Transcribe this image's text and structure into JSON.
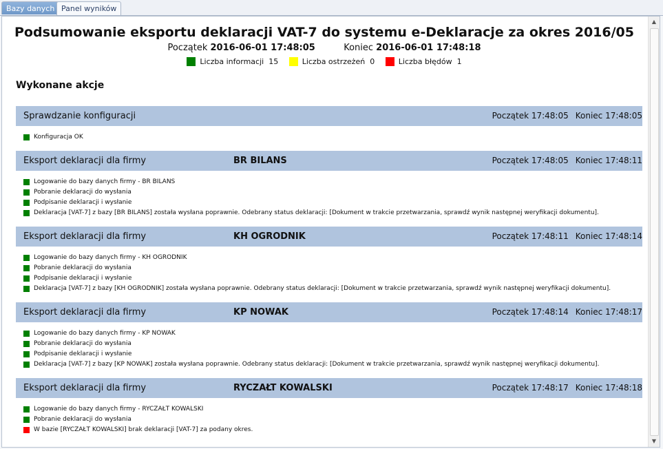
{
  "tabs": [
    {
      "label": "Bazy danych",
      "active": true
    },
    {
      "label": "Panel wyników",
      "active": false
    }
  ],
  "colors": {
    "info": "#008000",
    "warning": "#ffff00",
    "error": "#ff0000",
    "group_header": "#b0c4de"
  },
  "report": {
    "title": "Podsumowanie eksportu deklaracji VAT-7 do systemu e-Deklaracje za okres 2016/05",
    "start_label": "Początek",
    "start_value": "2016-06-01 17:48:05",
    "end_label": "Koniec",
    "end_value": "2016-06-01 17:48:18",
    "legend": [
      {
        "label": "Liczba informacji",
        "count": "15",
        "color": "#008000"
      },
      {
        "label": "Liczba ostrzeżeń",
        "count": "0",
        "color": "#ffff00"
      },
      {
        "label": "Liczba błędów",
        "count": "1",
        "color": "#ff0000"
      }
    ],
    "section_heading": "Wykonane akcje"
  },
  "groups": [
    {
      "title": "Sprawdzanie konfiguracji",
      "firm": "",
      "start": "Początek 17:48:05",
      "end": "Koniec 17:48:05",
      "items": [
        {
          "text": "Konfiguracja OK",
          "level": "info"
        }
      ]
    },
    {
      "title": "Eksport deklaracji dla firmy",
      "firm": "BR BILANS",
      "start": "Początek 17:48:05",
      "end": "Koniec 17:48:11",
      "items": [
        {
          "text": "Logowanie do bazy danych firmy - BR BILANS",
          "level": "info"
        },
        {
          "text": "Pobranie deklaracji do wysłania",
          "level": "info"
        },
        {
          "text": "Podpisanie deklaracji i wysłanie",
          "level": "info"
        },
        {
          "text": "Deklaracja [VAT-7] z bazy [BR BILANS] została wysłana poprawnie. Odebrany status deklaracji: [Dokument w trakcie przetwarzania, sprawdź wynik następnej weryfikacji dokumentu].",
          "level": "info"
        }
      ]
    },
    {
      "title": "Eksport deklaracji dla firmy",
      "firm": "KH OGRODNIK",
      "start": "Początek 17:48:11",
      "end": "Koniec 17:48:14",
      "items": [
        {
          "text": "Logowanie do bazy danych firmy - KH OGRODNIK",
          "level": "info"
        },
        {
          "text": "Pobranie deklaracji do wysłania",
          "level": "info"
        },
        {
          "text": "Podpisanie deklaracji i wysłanie",
          "level": "info"
        },
        {
          "text": "Deklaracja [VAT-7] z bazy [KH OGRODNIK] została wysłana poprawnie. Odebrany status deklaracji: [Dokument w trakcie przetwarzania, sprawdź wynik następnej weryfikacji dokumentu].",
          "level": "info"
        }
      ]
    },
    {
      "title": "Eksport deklaracji dla firmy",
      "firm": "KP NOWAK",
      "start": "Początek 17:48:14",
      "end": "Koniec 17:48:17",
      "items": [
        {
          "text": "Logowanie do bazy danych firmy - KP NOWAK",
          "level": "info"
        },
        {
          "text": "Pobranie deklaracji do wysłania",
          "level": "info"
        },
        {
          "text": "Podpisanie deklaracji i wysłanie",
          "level": "info"
        },
        {
          "text": "Deklaracja [VAT-7] z bazy [KP NOWAK] została wysłana poprawnie. Odebrany status deklaracji: [Dokument w trakcie przetwarzania, sprawdź wynik następnej weryfikacji dokumentu].",
          "level": "info"
        }
      ]
    },
    {
      "title": "Eksport deklaracji dla firmy",
      "firm": "RYCZAŁT KOWALSKI",
      "start": "Początek 17:48:17",
      "end": "Koniec 17:48:18",
      "items": [
        {
          "text": "Logowanie do bazy danych firmy - RYCZAŁT KOWALSKI",
          "level": "info"
        },
        {
          "text": "Pobranie deklaracji do wysłania",
          "level": "info"
        },
        {
          "text": "W bazie [RYCZAŁT KOWALSKI] brak deklaracji [VAT-7] za podany okres.",
          "level": "error"
        }
      ]
    }
  ]
}
